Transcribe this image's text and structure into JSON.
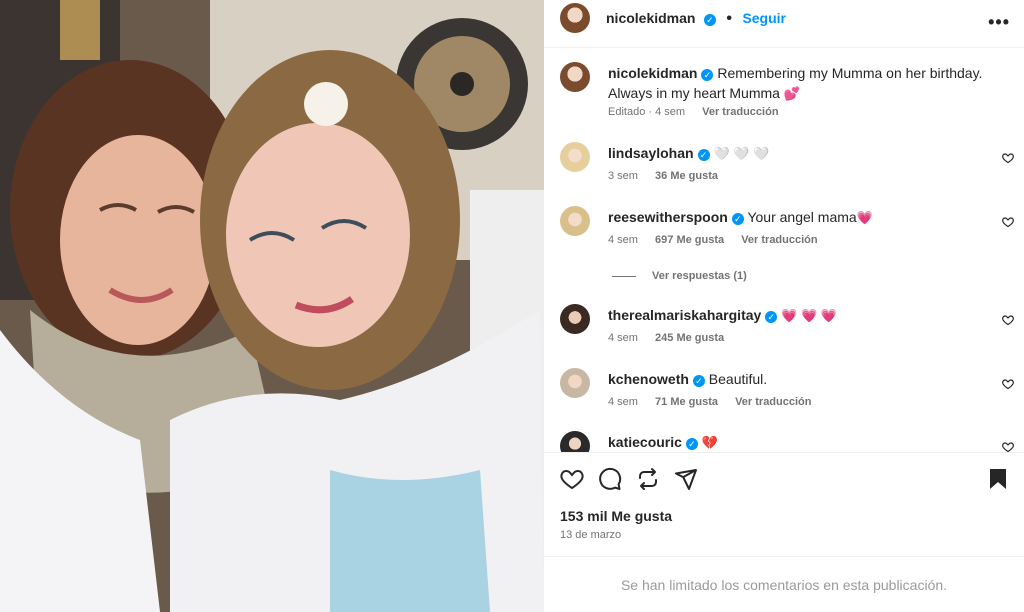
{
  "header": {
    "username": "nicolekidman",
    "follow_label": "Seguir",
    "more_label": "•••"
  },
  "caption": {
    "username": "nicolekidman",
    "text": "Remembering my Mumma on her birthday. Always in my heart Mumma",
    "emoji": "💕",
    "edited": "Editado",
    "time": "4 sem",
    "translate": "Ver traducción"
  },
  "comments": [
    {
      "username": "lindsaylohan",
      "text": "",
      "emoji": "🤍 🤍 🤍",
      "time": "3 sem",
      "likes": "36 Me gusta",
      "translate": ""
    },
    {
      "username": "reesewitherspoon",
      "text": "Your angel mama",
      "emoji": "💗",
      "time": "4 sem",
      "likes": "697 Me gusta",
      "translate": "Ver traducción"
    },
    {
      "username": "therealmariskahargitay",
      "text": "",
      "emoji": "💗 💗 💗",
      "time": "4 sem",
      "likes": "245 Me gusta",
      "translate": ""
    },
    {
      "username": "kchenoweth",
      "text": "Beautiful.",
      "emoji": "",
      "time": "4 sem",
      "likes": "71 Me gusta",
      "translate": "Ver traducción"
    },
    {
      "username": "katiecouric",
      "text": "",
      "emoji": "💔",
      "time": "",
      "likes": "",
      "translate": ""
    }
  ],
  "replies_label": "Ver respuestas (1)",
  "post": {
    "likes": "153 mil Me gusta",
    "date": "13 de marzo",
    "limited_notice": "Se han limitado los comentarios en esta publicación."
  },
  "icons": {
    "like": "heart-icon",
    "comment": "comment-icon",
    "share": "repost-icon",
    "send": "send-icon",
    "save": "bookmark-icon",
    "verified": "verified-badge-icon"
  },
  "colors": {
    "accent": "#0095f6",
    "muted": "#737373",
    "border": "#efefef"
  }
}
